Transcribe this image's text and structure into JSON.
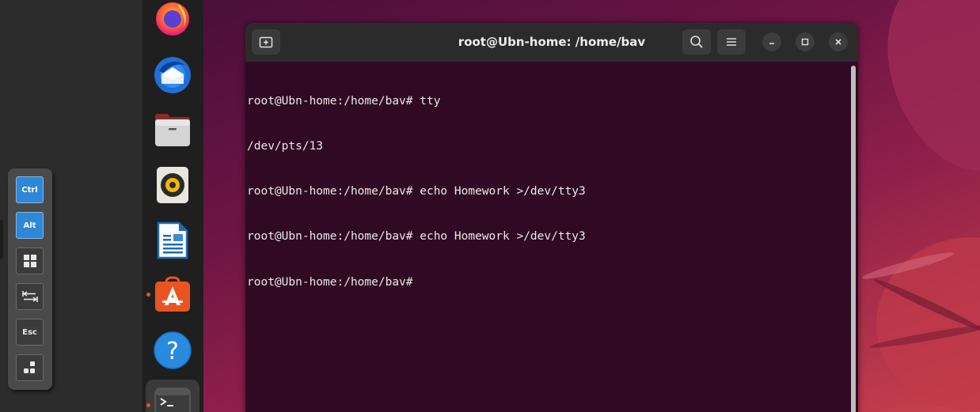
{
  "remote_keys": {
    "ctrl": "Ctrl",
    "alt": "Alt",
    "win_icon": "windows-icon",
    "tab_icon": "tab-icon",
    "esc": "Esc",
    "menu_icon": "keyboard-menu-icon"
  },
  "dock": {
    "apps": [
      {
        "name": "firefox-icon",
        "running": false
      },
      {
        "name": "thunderbird-icon",
        "running": false
      },
      {
        "name": "files-icon",
        "running": false
      },
      {
        "name": "rhythmbox-icon",
        "running": false
      },
      {
        "name": "libreoffice-writer-icon",
        "running": false
      },
      {
        "name": "app-center-icon",
        "running": true
      },
      {
        "name": "help-icon",
        "running": false
      },
      {
        "name": "terminal-icon",
        "running": true
      }
    ],
    "help_glyph": "?"
  },
  "terminal": {
    "title": "root@Ubn-home: /home/bav",
    "lines": [
      "root@Ubn-home:/home/bav# tty",
      "/dev/pts/13",
      "root@Ubn-home:/home/bav# echo Homework >/dev/tty3",
      "root@Ubn-home:/home/bav# echo Homework >/dev/tty3",
      "root@Ubn-home:/home/bav# "
    ],
    "background": "#300a24",
    "text_color": "#e8e8e8"
  },
  "colors": {
    "accent_blue": "#2f87d6",
    "ubuntu_orange": "#e95420"
  }
}
